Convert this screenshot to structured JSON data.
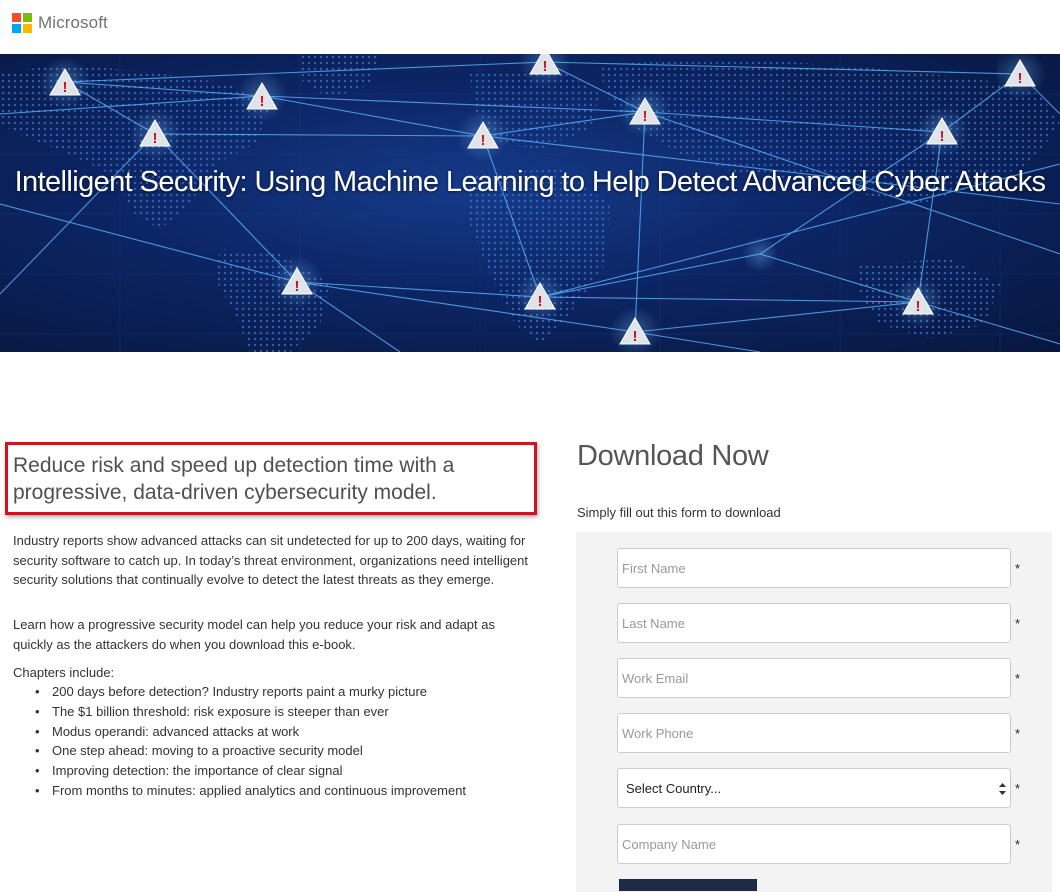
{
  "header": {
    "brand": "Microsoft",
    "logo_colors": [
      "#f25022",
      "#7fba00",
      "#00a4ef",
      "#ffb900"
    ]
  },
  "hero": {
    "title": "Intelligent Security: Using Machine Learning to Help Detect Advanced Cyber Attacks",
    "warning_icon": "warning-triangle-icon",
    "warning_mark": "!"
  },
  "content": {
    "headline": "Reduce risk and speed up detection time with a progressive, data-driven cybersecurity model.",
    "paragraph1": "Industry reports show advanced attacks can sit undetected for up to 200 days, waiting for security software to catch up. In today’s threat environment, organizations need intelligent security solutions that continually evolve to detect the latest threats as they emerge.",
    "paragraph2": "Learn how a progressive security model can help you reduce your risk and adapt as quickly as the attackers do when you download this e-book.",
    "chapters_label": "Chapters include:",
    "bullet": "•",
    "chapters": [
      "200 days before detection? Industry reports paint a murky picture",
      "The $1 billion threshold: risk exposure is steeper than ever",
      "Modus operandi: advanced attacks at work",
      "One step ahead: moving to a proactive security model",
      "Improving detection: the importance of clear signal",
      "From months to minutes: applied analytics and continuous improvement"
    ]
  },
  "form": {
    "title": "Download Now",
    "subtitle": "Simply fill out this form to download",
    "required_mark": "*",
    "fields": {
      "first_name": {
        "placeholder": "First Name",
        "value": ""
      },
      "last_name": {
        "placeholder": "Last Name",
        "value": ""
      },
      "work_email": {
        "placeholder": "Work Email",
        "value": ""
      },
      "work_phone": {
        "placeholder": "Work Phone",
        "value": ""
      },
      "company_name": {
        "placeholder": "Company Name",
        "value": ""
      }
    },
    "country_select": {
      "selected": "Select Country..."
    }
  },
  "colors": {
    "highlight_border": "#c8171e",
    "hero_background": "#0c2564",
    "hero_lines": "#5ab4ff",
    "form_panel": "#f3f3f3",
    "submit_button": "#1f2a44"
  }
}
